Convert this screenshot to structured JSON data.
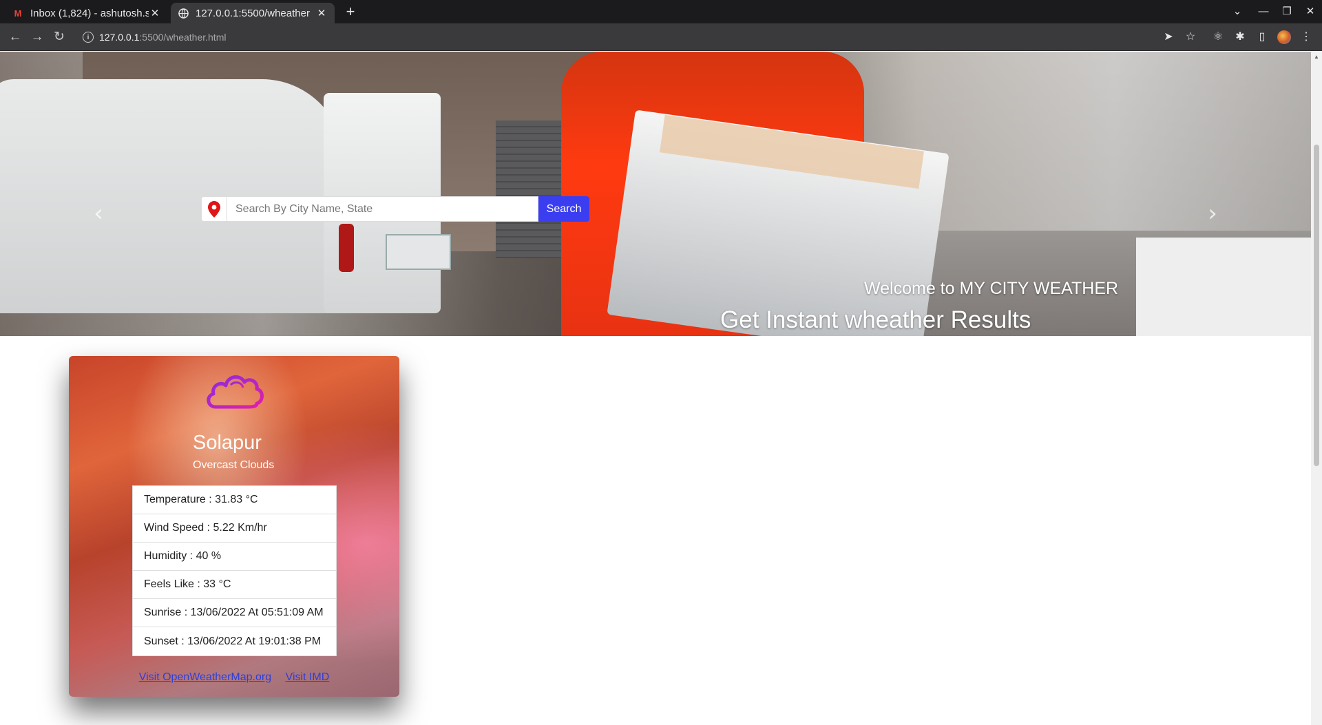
{
  "browser": {
    "tabs": [
      {
        "title": "Inbox (1,824) - ashutosh.s",
        "icon": "gmail-icon",
        "active": false
      },
      {
        "title": "127.0.0.1:5500/wheather",
        "icon": "globe-icon",
        "active": true
      }
    ],
    "new_tab_label": "+",
    "url_host": "127.0.0.1",
    "url_path": ":5500/wheather.html"
  },
  "hero": {
    "search_placeholder": "Search By City Name, State",
    "search_button": "Search",
    "welcome": "Welcome to MY CITY WEATHER",
    "headline": "Get Instant wheather Results"
  },
  "weather": {
    "icon": "cloud-icon",
    "city": "Solapur",
    "description": "Overcast Clouds",
    "rows": [
      "Temperature : 31.83 °C",
      "Wind Speed : 5.22 Km/hr",
      "Humidity : 40 %",
      "Feels Like : 33 °C",
      "Sunrise : 13/06/2022 At 05:51:09 AM",
      "Sunset : 13/06/2022 At 19:01:38 PM"
    ],
    "links": [
      "Visit OpenWeatherMap.org",
      "Visit IMD"
    ]
  },
  "colors": {
    "search_button": "#3b3ef0",
    "link": "#2f3ed8",
    "cloud_icon": "#b01fd0"
  }
}
